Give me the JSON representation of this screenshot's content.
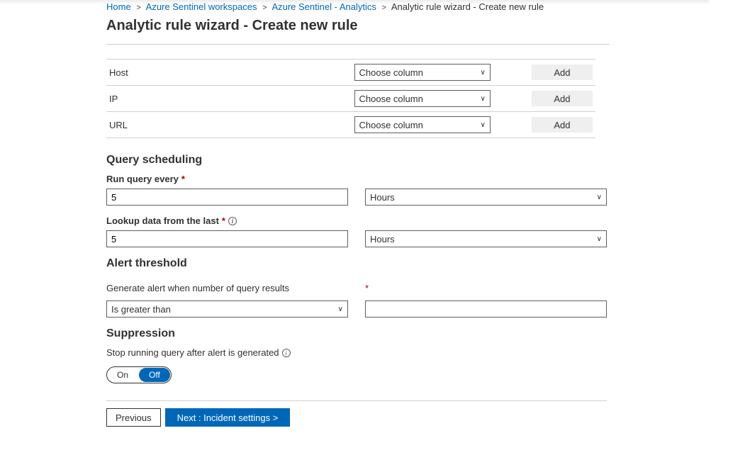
{
  "breadcrumbs": {
    "items": [
      {
        "label": "Home",
        "link": true
      },
      {
        "label": "Azure Sentinel workspaces",
        "link": true
      },
      {
        "label": "Azure Sentinel - Analytics",
        "link": true
      },
      {
        "label": "Analytic rule wizard - Create new rule",
        "link": false
      }
    ],
    "sep": ">"
  },
  "page_title": "Analytic rule wizard - Create new rule",
  "mapping": {
    "rows": [
      {
        "label": "Host"
      },
      {
        "label": "IP"
      },
      {
        "label": "URL"
      }
    ],
    "placeholder": "Choose column",
    "add_label": "Add"
  },
  "scheduling": {
    "section_title": "Query scheduling",
    "run_label": "Run query every",
    "run_value": "5",
    "run_unit": "Hours",
    "lookup_label": "Lookup data from the last",
    "lookup_value": "5",
    "lookup_unit": "Hours"
  },
  "threshold": {
    "section_title": "Alert threshold",
    "label": "Generate alert when number of query results",
    "operator": "Is greater than",
    "value": ""
  },
  "suppression": {
    "section_title": "Suppression",
    "label": "Stop running query after alert is generated",
    "on_label": "On",
    "off_label": "Off"
  },
  "footer": {
    "previous": "Previous",
    "next": "Next : Incident settings  >"
  }
}
